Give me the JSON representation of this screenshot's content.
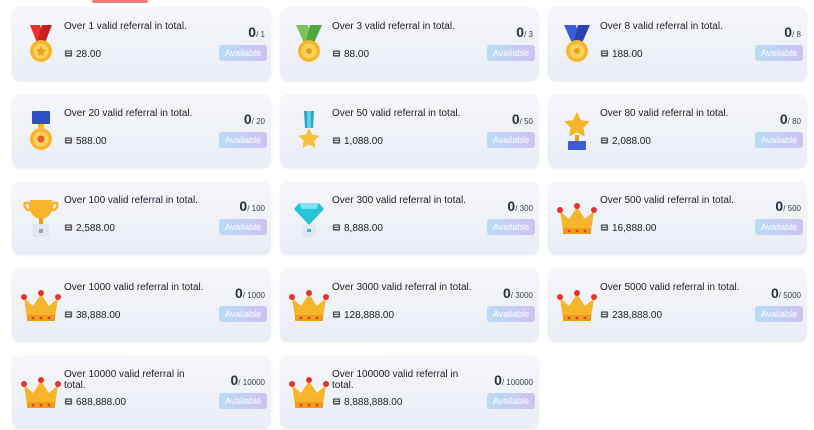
{
  "status_label": "Available",
  "colors": {
    "card_bg": "#eef1f7",
    "badge_from": "#b9dcf6",
    "badge_to": "#cfc1f1",
    "accent": "#f27a7a"
  },
  "achievements": [
    {
      "title": "Over 1 valid referral in total.",
      "reward": "28.00",
      "current": "0",
      "total": "/ 1",
      "icon": "red-ribbon-medal-icon"
    },
    {
      "title": "Over 3 valid referral in total.",
      "reward": "88.00",
      "current": "0",
      "total": "/ 3",
      "icon": "green-ribbon-medal-icon"
    },
    {
      "title": "Over 8 valid referral in total.",
      "reward": "188.00",
      "current": "0",
      "total": "/ 8",
      "icon": "blue-ribbon-medal-icon"
    },
    {
      "title": "Over 20 valid referral in total.",
      "reward": "588.00",
      "current": "0",
      "total": "/ 20",
      "icon": "navy-medal-icon"
    },
    {
      "title": "Over 50 valid referral in total.",
      "reward": "1,088.00",
      "current": "0",
      "total": "/ 50",
      "icon": "star-medal-icon"
    },
    {
      "title": "Over 80 valid referral in total.",
      "reward": "2,088.00",
      "current": "0",
      "total": "/ 80",
      "icon": "star-trophy-icon"
    },
    {
      "title": "Over 100 valid referral in total.",
      "reward": "2,588.00",
      "current": "0",
      "total": "/ 100",
      "icon": "gold-cup-icon"
    },
    {
      "title": "Over 300 valid referral in total.",
      "reward": "8,888.00",
      "current": "0",
      "total": "/ 300",
      "icon": "diamond-trophy-icon"
    },
    {
      "title": "Over 500 valid referral in total.",
      "reward": "16,888.00",
      "current": "0",
      "total": "/ 500",
      "icon": "crown-icon"
    },
    {
      "title": "Over 1000 valid referral in total.",
      "reward": "38,888.00",
      "current": "0",
      "total": "/ 1000",
      "icon": "crown-icon"
    },
    {
      "title": "Over 3000 valid referral in total.",
      "reward": "128,888.00",
      "current": "0",
      "total": "/ 3000",
      "icon": "crown-icon"
    },
    {
      "title": "Over 5000 valid referral in total.",
      "reward": "238,888.00",
      "current": "0",
      "total": "/ 5000",
      "icon": "crown-icon"
    },
    {
      "title": "Over 10000 valid referral in total.",
      "reward": "688,888.00",
      "current": "0",
      "total": "/ 10000",
      "icon": "crown-icon"
    },
    {
      "title": "Over 100000 valid referral in total.",
      "reward": "8,888,888.00",
      "current": "0",
      "total": "/ 100000",
      "icon": "crown-icon"
    }
  ]
}
